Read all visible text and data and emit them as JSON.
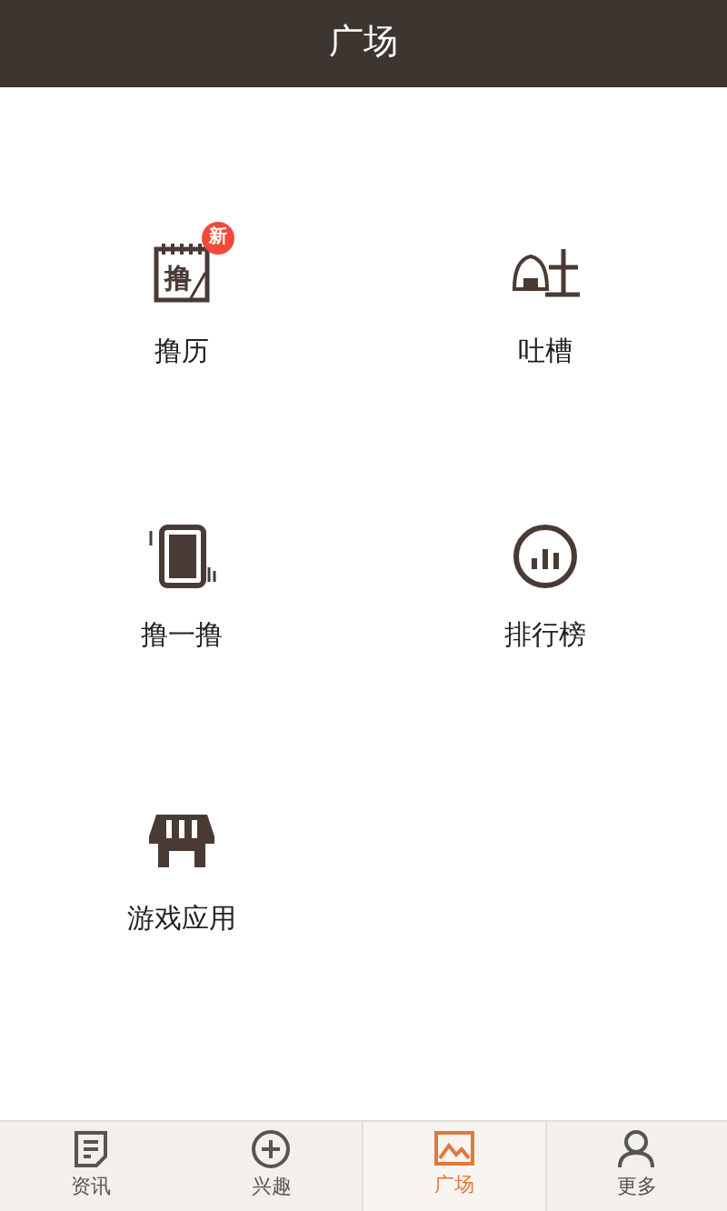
{
  "header": {
    "title": "广场"
  },
  "items": [
    {
      "label": "撸历",
      "kind": "calendar",
      "icon_text": "撸",
      "badge": "新"
    },
    {
      "label": "吐槽",
      "kind": "onigiri"
    },
    {
      "label": "撸一撸",
      "kind": "phone"
    },
    {
      "label": "排行榜",
      "kind": "chart"
    },
    {
      "label": "游戏应用",
      "kind": "shop"
    }
  ],
  "tabs": [
    {
      "label": "资讯",
      "kind": "doc",
      "selected": false
    },
    {
      "label": "兴趣",
      "kind": "plus",
      "selected": false
    },
    {
      "label": "广场",
      "kind": "picture",
      "selected": true
    },
    {
      "label": "更多",
      "kind": "person",
      "selected": false
    }
  ]
}
